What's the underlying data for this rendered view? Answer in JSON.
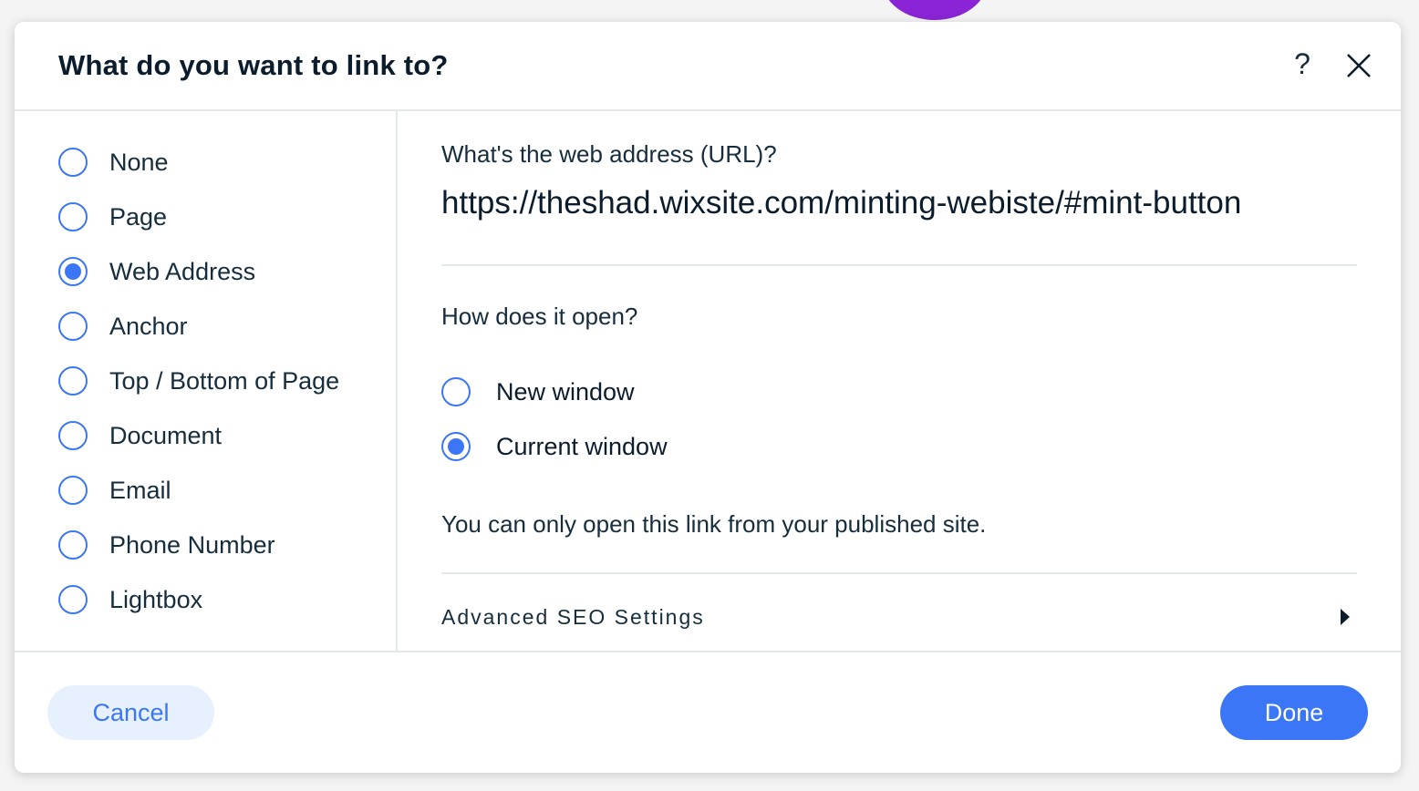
{
  "dialog": {
    "title": "What do you want to link to?",
    "help_label": "?"
  },
  "sidebar": {
    "items": [
      {
        "label": "None",
        "checked": false
      },
      {
        "label": "Page",
        "checked": false
      },
      {
        "label": "Web Address",
        "checked": true
      },
      {
        "label": "Anchor",
        "checked": false
      },
      {
        "label": "Top / Bottom of Page",
        "checked": false
      },
      {
        "label": "Document",
        "checked": false
      },
      {
        "label": "Email",
        "checked": false
      },
      {
        "label": "Phone Number",
        "checked": false
      },
      {
        "label": "Lightbox",
        "checked": false
      }
    ]
  },
  "main": {
    "url_label": "What's the web address (URL)?",
    "url_value": "https://theshad.wixsite.com/minting-webiste/#mint-button",
    "open_label": "How does it open?",
    "open_options": [
      {
        "label": "New window",
        "checked": false
      },
      {
        "label": "Current window",
        "checked": true
      }
    ],
    "note": "You can only open this link from your published site.",
    "seo_label": "Advanced SEO Settings"
  },
  "footer": {
    "cancel_label": "Cancel",
    "done_label": "Done"
  },
  "colors": {
    "accent": "#3b76f6",
    "accent_light": "#e7f0ff",
    "text": "#162d3d",
    "divider": "#e3e8ec"
  }
}
